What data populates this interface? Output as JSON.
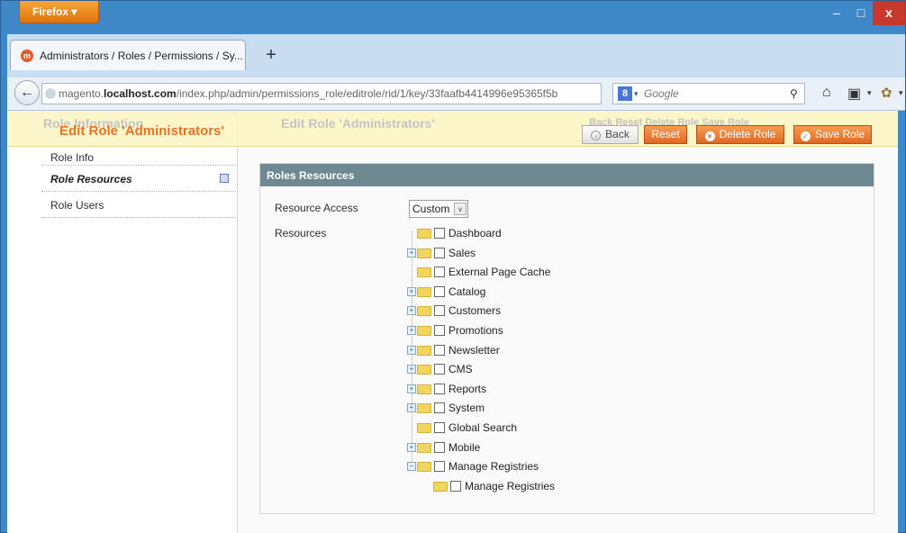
{
  "browser": {
    "menu_label": "Firefox",
    "tab_title": "Administrators / Roles / Permissions / Sy...",
    "new_tab": "+",
    "url_prefix": "magento.",
    "url_domain": "localhost.com",
    "url_path": "/index.php/admin/permissions_role/editrole/rid/1/key/33faafb4414996e95365f5b",
    "search_placeholder": "Google",
    "search_engine": "8",
    "window_controls": {
      "min": "–",
      "max": "□",
      "close": "x"
    }
  },
  "page": {
    "title": "Edit Role 'Administrators'",
    "ghost_sidebar_title": "Role Information",
    "ghost_main_title": "Edit Role 'Administrators'",
    "ghost_buttons": "Back   Reset   Delete Role   Save Role",
    "buttons": {
      "back": "Back",
      "reset": "Reset",
      "delete": "Delete Role",
      "save": "Save Role"
    }
  },
  "sidebar": {
    "items": [
      {
        "label": "Role Info"
      },
      {
        "label": "Role Resources"
      },
      {
        "label": "Role Users"
      }
    ]
  },
  "panel": {
    "heading": "Roles Resources",
    "resource_access_label": "Resource Access",
    "resource_access_value": "Custom",
    "resources_label": "Resources",
    "tree": [
      {
        "label": "Dashboard",
        "expandable": false
      },
      {
        "label": "Sales",
        "expandable": true
      },
      {
        "label": "External Page Cache",
        "expandable": false
      },
      {
        "label": "Catalog",
        "expandable": true
      },
      {
        "label": "Customers",
        "expandable": true
      },
      {
        "label": "Promotions",
        "expandable": true
      },
      {
        "label": "Newsletter",
        "expandable": true
      },
      {
        "label": "CMS",
        "expandable": true
      },
      {
        "label": "Reports",
        "expandable": true
      },
      {
        "label": "System",
        "expandable": true
      },
      {
        "label": "Global Search",
        "expandable": false
      },
      {
        "label": "Mobile",
        "expandable": true
      },
      {
        "label": "Manage Registries",
        "expandable": true,
        "expanded": true
      },
      {
        "label": "Manage Registries",
        "expandable": false,
        "child": true
      }
    ]
  },
  "colors": {
    "titlebar": "#3f88c8",
    "accent_orange": "#e86e1b",
    "panel_header": "#6f8992",
    "header_bg": "#fdf6c8"
  }
}
